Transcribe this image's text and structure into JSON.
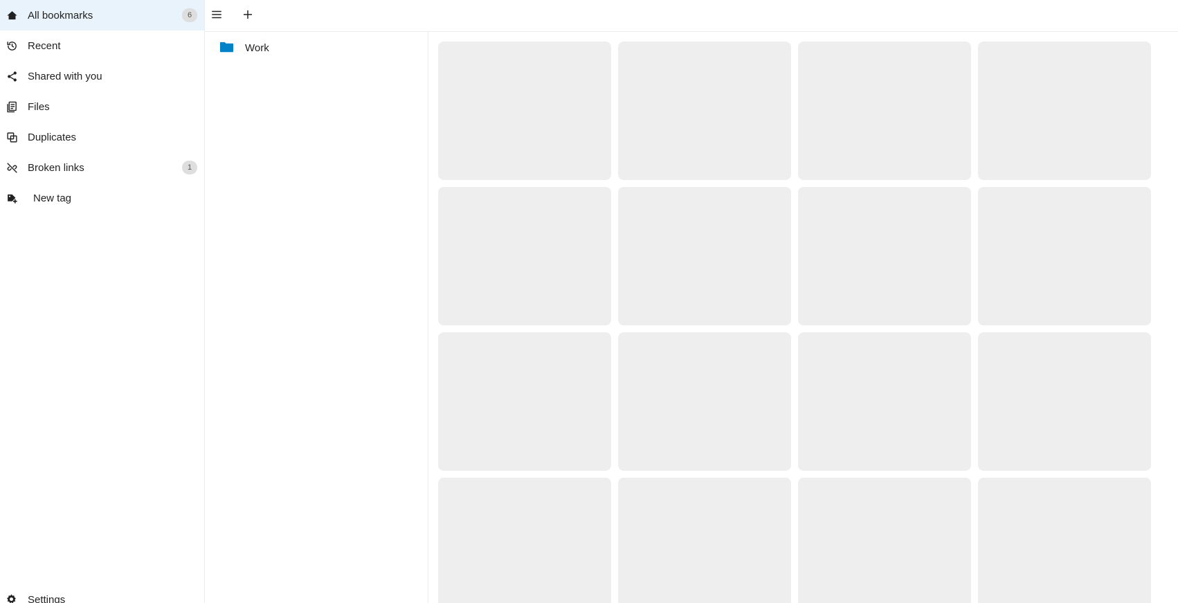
{
  "sidebar": {
    "items": [
      {
        "label": "All bookmarks",
        "badge": "6",
        "icon": "home-icon",
        "active": true
      },
      {
        "label": "Recent",
        "icon": "history-icon"
      },
      {
        "label": "Shared with you",
        "icon": "share-icon"
      },
      {
        "label": "Files",
        "icon": "file-document-icon"
      },
      {
        "label": "Duplicates",
        "icon": "duplicate-icon"
      },
      {
        "label": "Broken links",
        "badge": "1",
        "icon": "link-off-icon"
      },
      {
        "label": "New tag",
        "icon": "tag-plus-icon"
      }
    ],
    "settings_label": "Settings"
  },
  "toolbar": {
    "menu_icon": "hamburger-menu-icon",
    "add_icon": "plus-icon"
  },
  "folders": [
    {
      "label": "Work",
      "icon": "folder-icon",
      "color": "#0082c9"
    }
  ],
  "grid": {
    "placeholder_count": 16,
    "placeholder_color": "#eeeeee"
  },
  "colors": {
    "active_bg": "#e8f3fb",
    "accent": "#0082c9",
    "badge_bg": "#dedede"
  }
}
